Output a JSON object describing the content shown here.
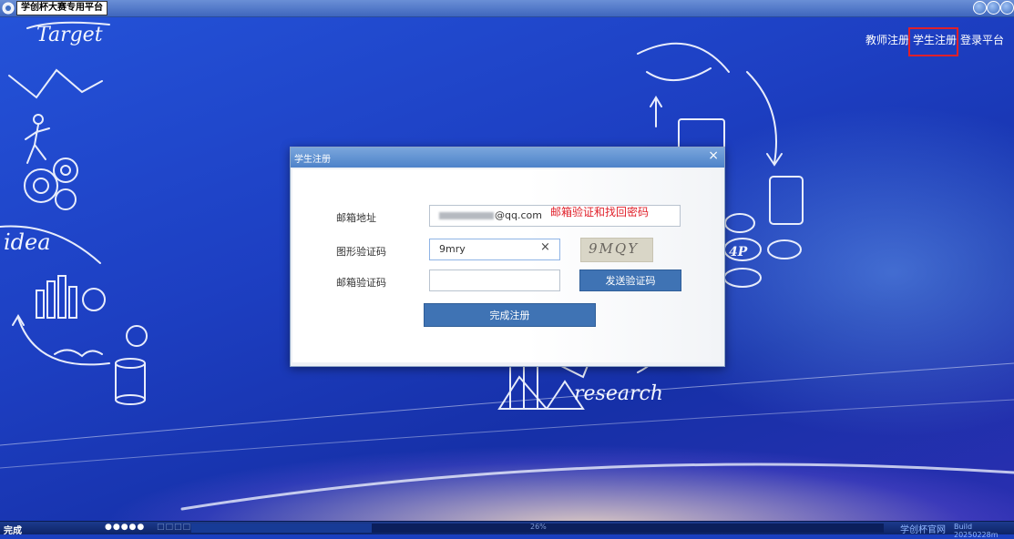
{
  "window": {
    "title": "学创杯大赛专用平台"
  },
  "nav": {
    "teacher_register": "教师注册",
    "student_register": "学生注册",
    "login_platform": "登录平台"
  },
  "background": {
    "words": [
      "Target",
      "idea",
      "research"
    ]
  },
  "dialog": {
    "title": "学生注册",
    "close_symbol": "×",
    "email_label": "邮箱地址",
    "email_value": "@qq.com",
    "email_note": "邮箱验证和找回密码",
    "captcha_label": "图形验证码",
    "captcha_value": "9mry",
    "captcha_clear": "×",
    "captcha_image_text": "9MQY",
    "email_code_label": "邮箱验证码",
    "email_code_value": "",
    "send_code_button": "发送验证码",
    "submit_button": "完成注册"
  },
  "statusbar": {
    "status_text": "完成",
    "dots_filled": "●●●●●",
    "dots_empty": "□□□□□",
    "progress_percent": "26%",
    "progress": 0.26,
    "site_link": "学创杯官网",
    "build": "Build 20250228m"
  },
  "colors": {
    "dialog_header": "#4d82c9",
    "button": "#3f73b4",
    "highlight": "#e0202a",
    "note": "#e0202a"
  }
}
